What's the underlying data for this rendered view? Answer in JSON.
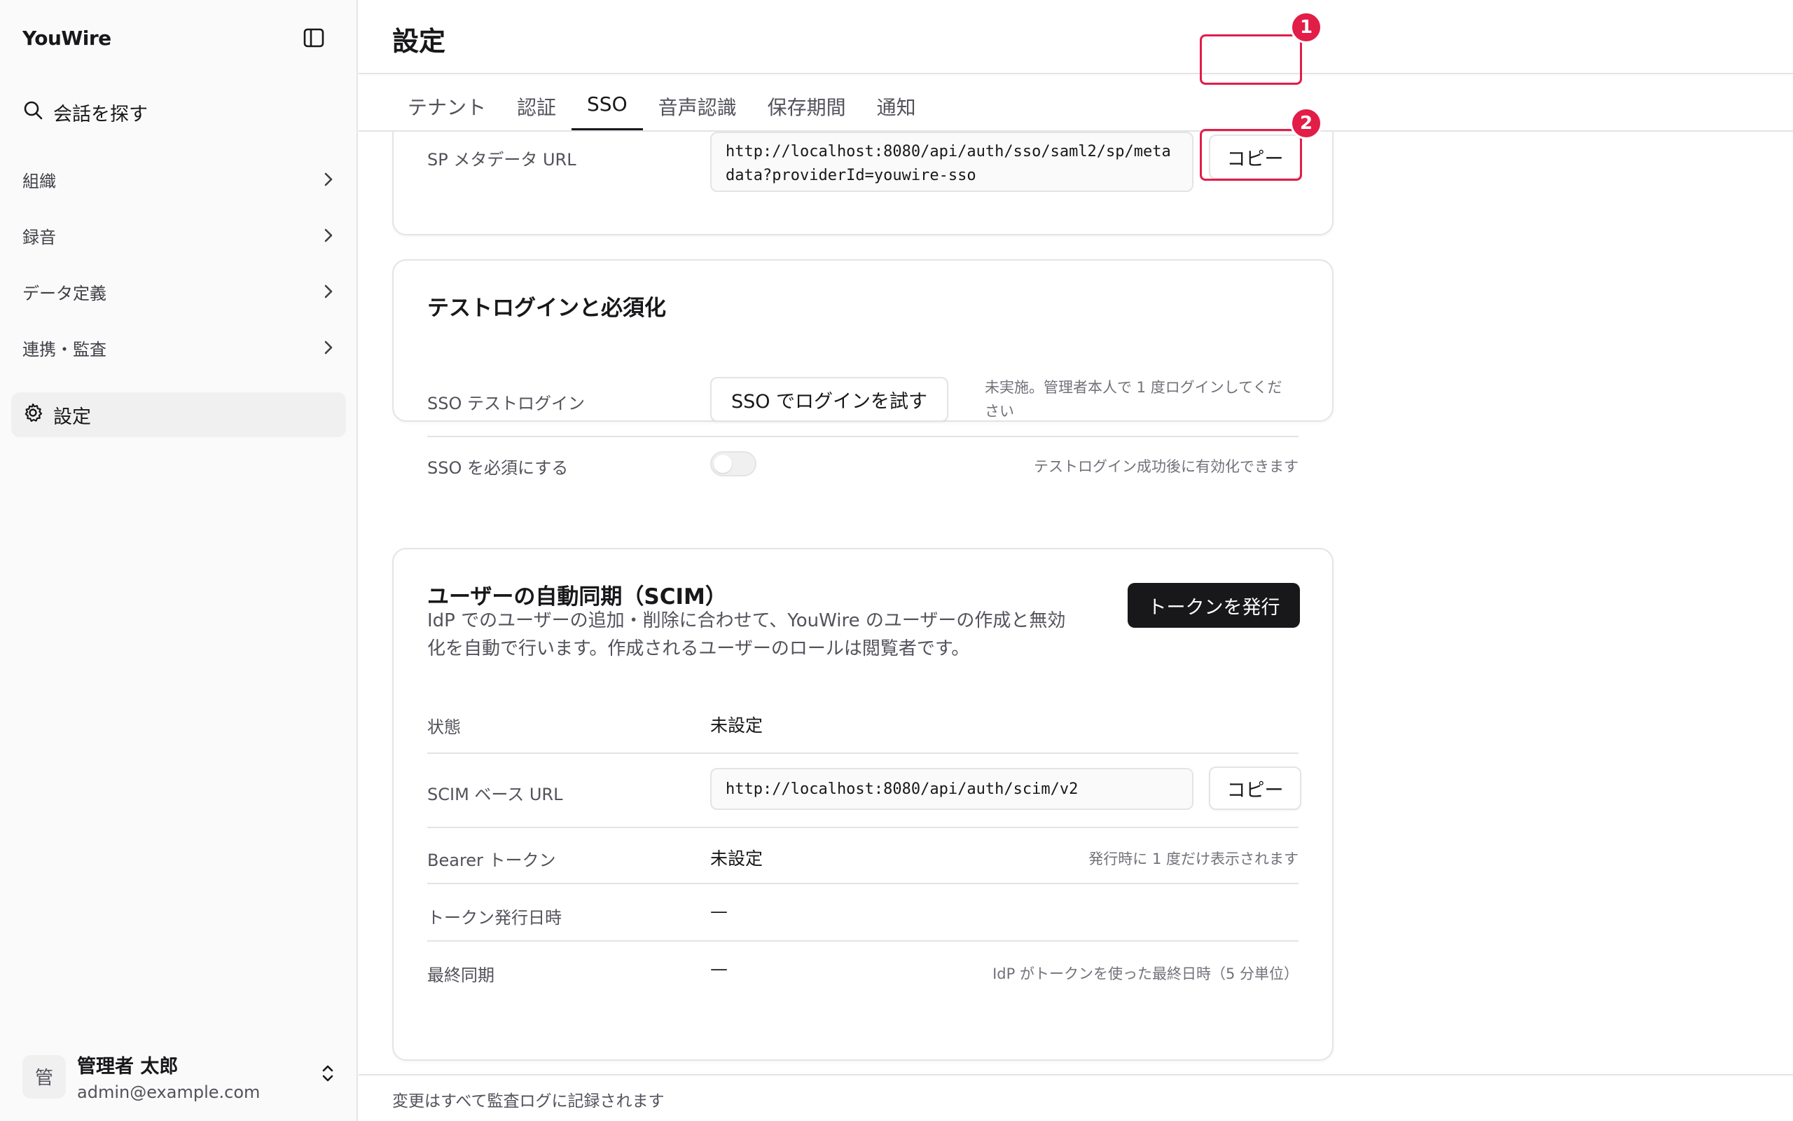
{
  "app": {
    "name": "YouWire"
  },
  "sidebar": {
    "search_label": "会話を探す",
    "items": [
      {
        "label": "組織"
      },
      {
        "label": "録音"
      },
      {
        "label": "データ定義"
      },
      {
        "label": "連携・監査"
      }
    ],
    "active_label": "設定"
  },
  "user": {
    "avatar_initial": "管",
    "name": "管理者 太郎",
    "email": "admin@example.com"
  },
  "header": {
    "title": "設定"
  },
  "tabs": [
    {
      "label": "テナント"
    },
    {
      "label": "認証"
    },
    {
      "label": "SSO",
      "active": true
    },
    {
      "label": "音声認識"
    },
    {
      "label": "保存期間"
    },
    {
      "label": "通知"
    }
  ],
  "sp_card": {
    "metadata_label": "SP メタデータ URL",
    "metadata_url_line1": "http://localhost:8080/api/auth/sso/saml2/sp/meta",
    "metadata_url_line2": "data?providerId=youwire-sso",
    "copy_label": "コピー"
  },
  "test_card": {
    "title": "テストログインと必須化",
    "test_label": "SSO テストログイン",
    "test_button": "SSO でログインを試す",
    "test_hint_line1": "未実施。管理者本人で 1 度ログインしてくだ",
    "test_hint_line2": "さい",
    "require_label": "SSO を必須にする",
    "require_hint": "テストログイン成功後に有効化できます"
  },
  "scim_card": {
    "title": "ユーザーの自動同期（SCIM）",
    "desc_line1": "IdP でのユーザーの追加・削除に合わせて、YouWire のユーザーの作成と無効",
    "desc_line2": "化を自動で行います。作成されるユーザーのロールは閲覧者です。",
    "issue_button": "トークンを発行",
    "status_label": "状態",
    "status_value": "未設定",
    "base_url_label": "SCIM ベース URL",
    "base_url_value": "http://localhost:8080/api/auth/scim/v2",
    "copy_label": "コピー",
    "bearer_label": "Bearer トークン",
    "bearer_value": "未設定",
    "bearer_hint": "発行時に 1 度だけ表示されます",
    "issued_label": "トークン発行日時",
    "issued_value": "—",
    "last_sync_label": "最終同期",
    "last_sync_value": "—",
    "last_sync_hint": "IdP がトークンを使った最終日時（5 分単位）"
  },
  "annotations": {
    "badge1": "1",
    "badge2": "2"
  },
  "footer": {
    "note": "変更はすべて監査ログに記録されます"
  },
  "colors": {
    "accent": "#e11d48",
    "dark_button": "#18181b",
    "sidebar_bg": "#fafafa"
  },
  "icons": [
    "sidebar-toggle-icon",
    "search-icon",
    "chevron-right-icon",
    "gear-icon",
    "chevron-up-down-icon"
  ]
}
